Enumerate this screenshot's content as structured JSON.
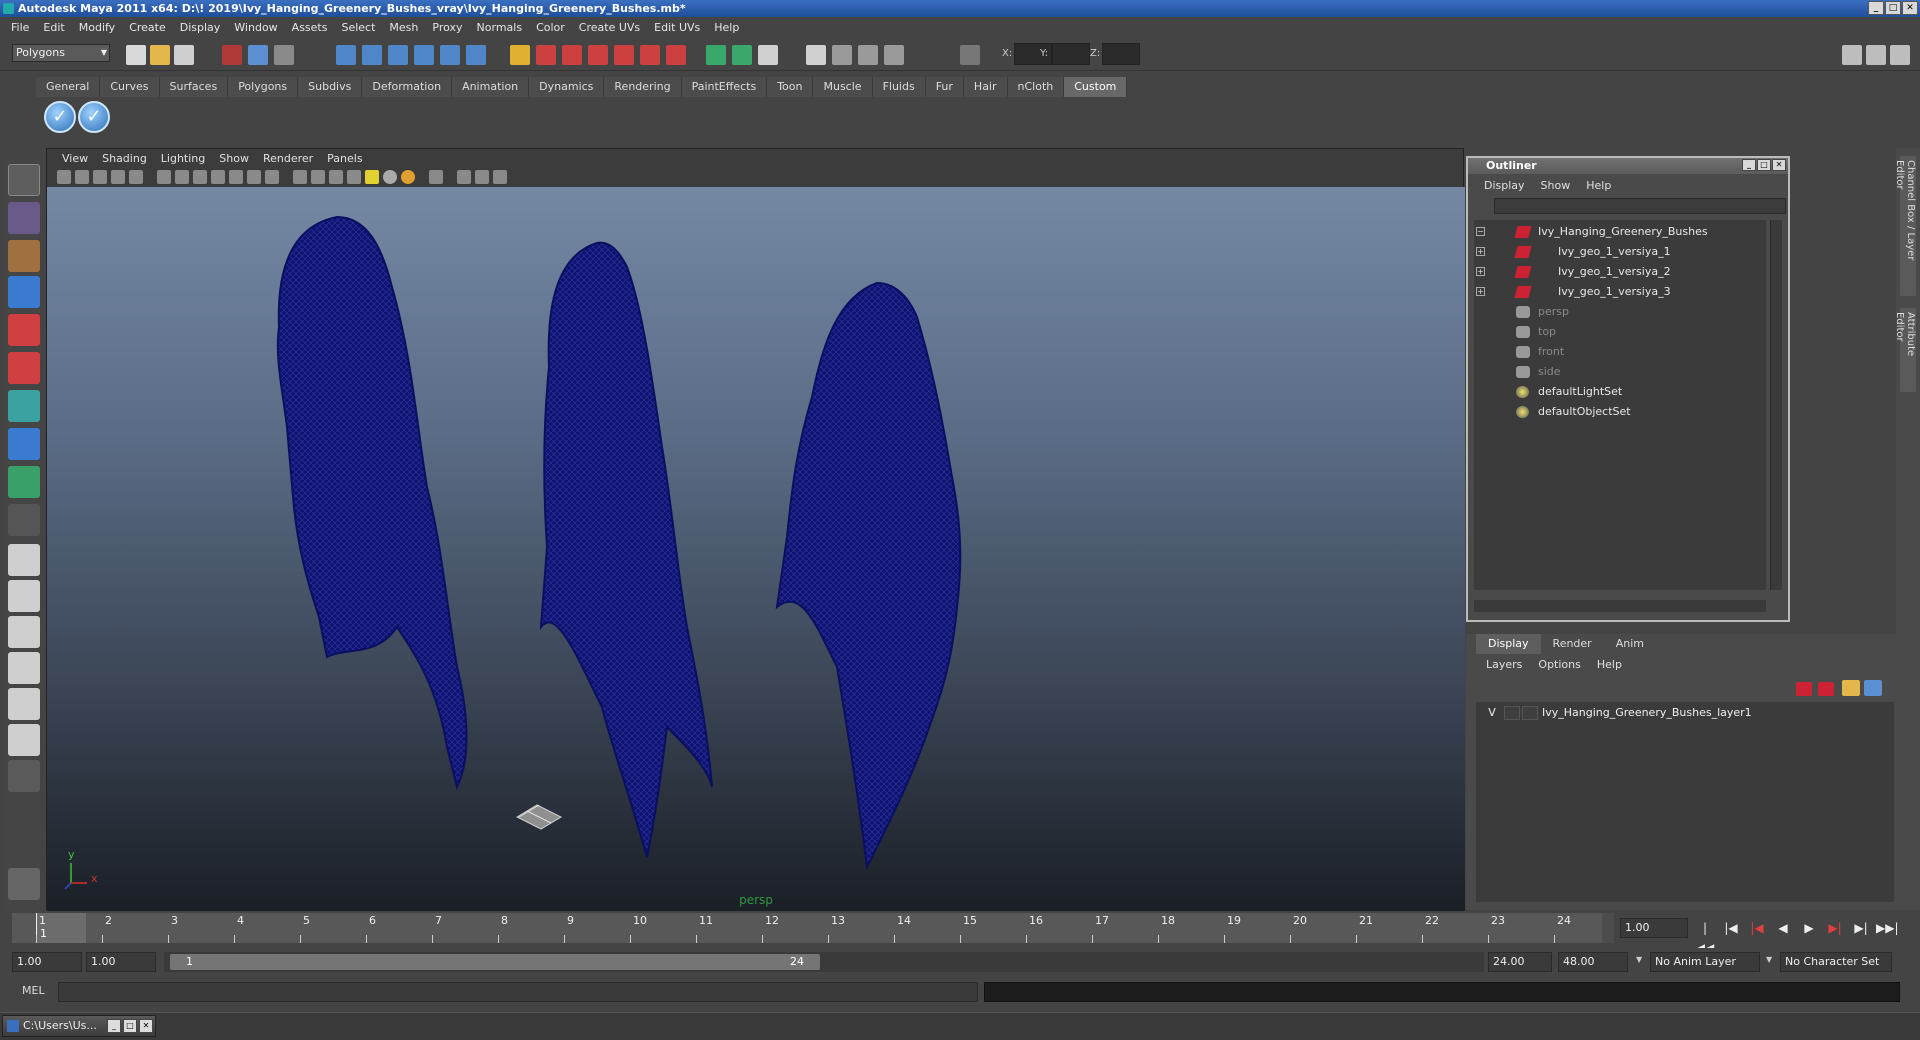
{
  "window": {
    "title": "Autodesk Maya 2011 x64: D:\\! 2019\\Ivy_Hanging_Greenery_Bushes_vray\\Ivy_Hanging_Greenery_Bushes.mb*",
    "buttons": [
      "_",
      "□",
      "✕"
    ]
  },
  "main_menu": [
    "File",
    "Edit",
    "Modify",
    "Create",
    "Display",
    "Window",
    "Assets",
    "Select",
    "Mesh",
    "Proxy",
    "Normals",
    "Color",
    "Create UVs",
    "Edit UVs",
    "Help"
  ],
  "status_line": {
    "mode": "Polygons",
    "x_label": "X:",
    "y_label": "Y:",
    "z_label": "Z:"
  },
  "shelf": {
    "tabs": [
      "General",
      "Curves",
      "Surfaces",
      "Polygons",
      "Subdivs",
      "Deformation",
      "Animation",
      "Dynamics",
      "Rendering",
      "PaintEffects",
      "Toon",
      "Muscle",
      "Fluids",
      "Fur",
      "Hair",
      "nCloth",
      "Custom"
    ],
    "active_tab": "Custom",
    "button_glyph": "✓"
  },
  "viewport": {
    "menu": [
      "View",
      "Shading",
      "Lighting",
      "Show",
      "Renderer",
      "Panels"
    ],
    "camera_label": "persp",
    "axis_y": "y",
    "axis_x": "x",
    "object_color": "#0f1370"
  },
  "outliner": {
    "title": "Outliner",
    "menu": [
      "Display",
      "Show",
      "Help"
    ],
    "items": [
      {
        "label": "Ivy_Hanging_Greenery_Bushes",
        "expand": "−",
        "icon": "mesh",
        "indent": 0,
        "dim": false
      },
      {
        "label": "Ivy_geo_1_versiya_1",
        "expand": "+",
        "icon": "mesh",
        "indent": 1,
        "dim": false
      },
      {
        "label": "Ivy_geo_1_versiya_2",
        "expand": "+",
        "icon": "mesh",
        "indent": 1,
        "dim": false
      },
      {
        "label": "Ivy_geo_1_versiya_3",
        "expand": "+",
        "icon": "mesh",
        "indent": 1,
        "dim": false
      },
      {
        "label": "persp",
        "expand": "",
        "icon": "cam",
        "indent": 0,
        "dim": true
      },
      {
        "label": "top",
        "expand": "",
        "icon": "cam",
        "indent": 0,
        "dim": true
      },
      {
        "label": "front",
        "expand": "",
        "icon": "cam",
        "indent": 0,
        "dim": true
      },
      {
        "label": "side",
        "expand": "",
        "icon": "cam",
        "indent": 0,
        "dim": true
      },
      {
        "label": "defaultLightSet",
        "expand": "",
        "icon": "set",
        "indent": 0,
        "dim": false
      },
      {
        "label": "defaultObjectSet",
        "expand": "",
        "icon": "set",
        "indent": 0,
        "dim": false
      }
    ]
  },
  "right_tabs": [
    "Channel Box / Layer Editor",
    "Attribute Editor"
  ],
  "layer_editor": {
    "tabs": [
      "Display",
      "Render",
      "Anim"
    ],
    "active_tab": "Display",
    "menu": [
      "Layers",
      "Options",
      "Help"
    ],
    "layers": [
      {
        "visible": "V",
        "name": "Ivy_Hanging_Greenery_Bushes_layer1"
      }
    ]
  },
  "time_slider": {
    "ticks": [
      1,
      2,
      3,
      4,
      5,
      6,
      7,
      8,
      9,
      10,
      11,
      12,
      13,
      14,
      15,
      16,
      17,
      18,
      19,
      20,
      21,
      22,
      23,
      24
    ],
    "current_frame": "1",
    "current_time_field": "1.00"
  },
  "range_slider": {
    "start_time": "1.00",
    "playback_start": "1.00",
    "handle_start": "1",
    "handle_end": "24",
    "playback_end": "24.00",
    "end_time": "48.00",
    "anim_layer": "No Anim Layer",
    "character_set": "No Character Set"
  },
  "command_line": {
    "label": "MEL"
  },
  "taskbar": {
    "item": "C:\\Users\\Us..."
  }
}
